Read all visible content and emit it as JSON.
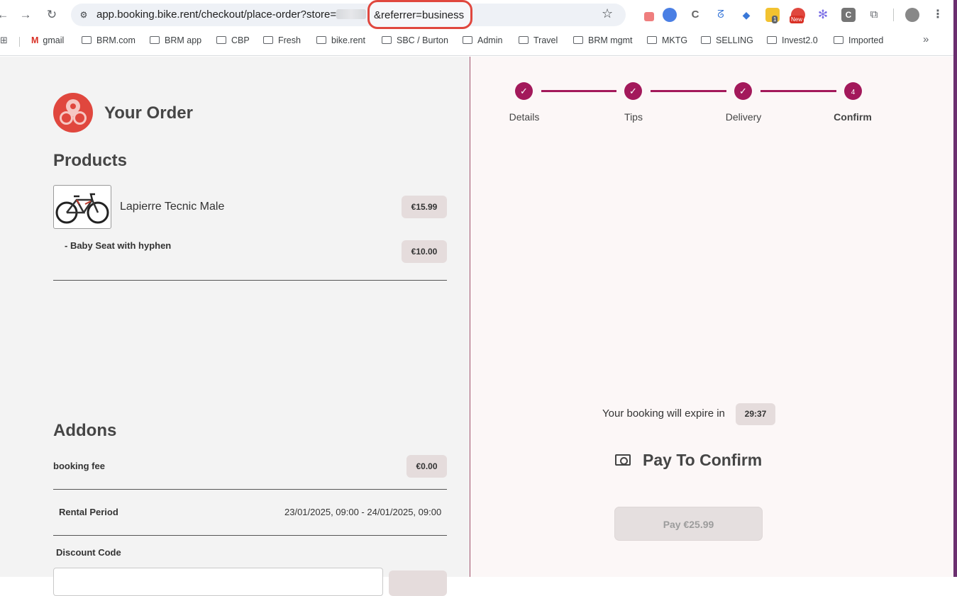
{
  "browser": {
    "url_main": "app.booking.bike.rent/checkout/place-order?store=",
    "url_highlight": "&referrer=business",
    "bookmarks": [
      "gmail",
      "BRM.com",
      "BRM app",
      "CBP",
      "Fresh",
      "bike.rent",
      "SBC / Burton",
      "Admin",
      "Travel",
      "BRM mgmt",
      "MKTG",
      "SELLING",
      "Invest2.0",
      "Imported"
    ],
    "ext_badge_count": "1",
    "ext_badge_new": "New",
    "more_bookmarks": "»"
  },
  "order": {
    "title": "Your Order",
    "products_heading": "Products",
    "product_name": "Lapierre Tecnic Male",
    "product_price": "€15.99",
    "addon_item_label": "- Baby Seat with hyphen",
    "addon_item_price": "€10.00",
    "addons_heading": "Addons",
    "fee_label": "booking fee",
    "fee_price": "€0.00",
    "rental_label": "Rental Period",
    "rental_value": "23/01/2025, 09:00 - 24/01/2025, 09:00",
    "discount_label": "Discount Code"
  },
  "stepper": {
    "steps": [
      {
        "label": "Details",
        "state": "done"
      },
      {
        "label": "Tips",
        "state": "done"
      },
      {
        "label": "Delivery",
        "state": "done"
      },
      {
        "label": "Confirm",
        "state": "active",
        "number": "4"
      }
    ],
    "accent": "#a3195b"
  },
  "payment": {
    "expire_text": "Your booking will expire in",
    "timer": "29:37",
    "title": "Pay To Confirm",
    "button": "Pay €25.99"
  },
  "colors": {
    "brand": "#e0473e",
    "accent": "#a3195b",
    "pill": "#e5dcdc"
  }
}
